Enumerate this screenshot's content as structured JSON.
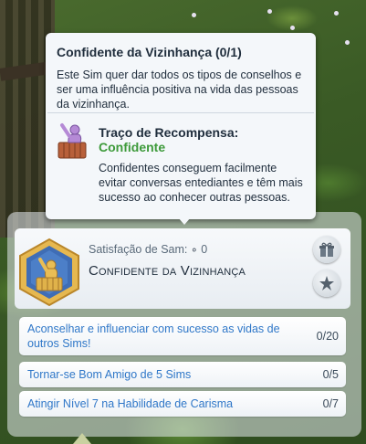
{
  "tooltip": {
    "title": "Confidente da Vizinhança (0/1)",
    "description": "Este Sim quer dar todos os tipos de conselhos e ser uma influência positiva na vida das pessoas da vizinhança.",
    "reward_heading": "Traço de Recompensa:",
    "reward_name": "Confidente",
    "reward_description": "Confidentes conseguem facilmente evitar conversas entediantes e têm mais sucesso ao conhecer outras pessoas.",
    "reward_icon": "confidant-trait-icon"
  },
  "aspiration": {
    "satisfaction_label": "Satisfação de Sam:",
    "satisfaction_points": "0",
    "title": "Confidente da Vizinhança",
    "icon": "aspiration-hex-icon"
  },
  "actions": {
    "gift_icon": "gift-icon",
    "star_icon": "star-icon"
  },
  "tasks": [
    {
      "label": "Aconselhar e influenciar com sucesso as vidas de outros Sims!",
      "progress": "0/20"
    },
    {
      "label": "Tornar-se Bom Amigo de 5 Sims",
      "progress": "0/5"
    },
    {
      "label": "Atingir Nível 7 na Habilidade de Carisma",
      "progress": "0/7"
    }
  ],
  "colors": {
    "task_text": "#2f77c8",
    "reward_green": "#3d9a3a",
    "aspiration_gold": "#d9a93a"
  }
}
